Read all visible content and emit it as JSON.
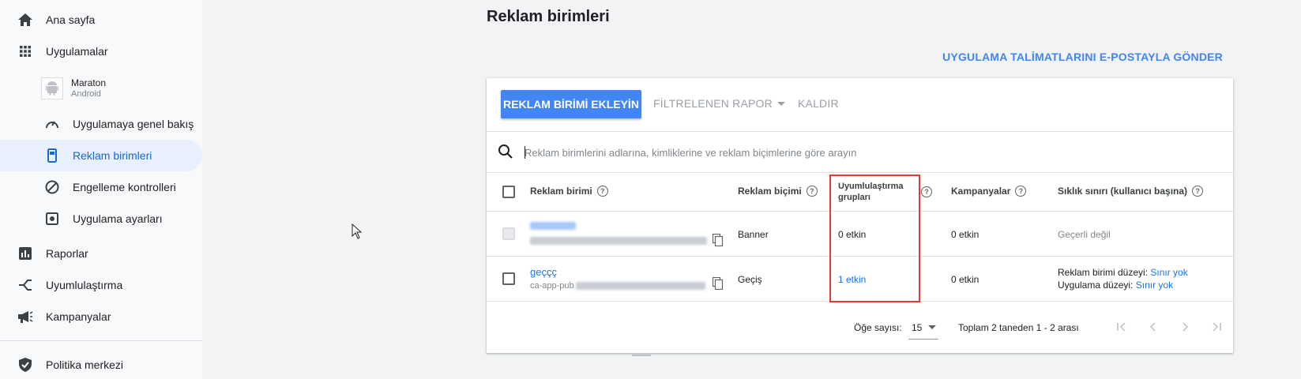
{
  "sidebar": {
    "items": [
      {
        "label": "Ana sayfa",
        "icon": "home-icon"
      },
      {
        "label": "Uygulamalar",
        "icon": "apps-grid-icon"
      },
      {
        "label": "Uygulamaya genel bakış",
        "icon": "speedometer-icon"
      },
      {
        "label": "Reklam birimleri",
        "icon": "ad-unit-icon"
      },
      {
        "label": "Engelleme kontrolleri",
        "icon": "block-icon"
      },
      {
        "label": "Uygulama ayarları",
        "icon": "settings-icon"
      },
      {
        "label": "Raporlar",
        "icon": "reports-icon"
      },
      {
        "label": "Uyumlulaştırma",
        "icon": "mediation-icon"
      },
      {
        "label": "Kampanyalar",
        "icon": "megaphone-icon"
      },
      {
        "label": "Politika merkezi",
        "icon": "shield-check-icon"
      }
    ],
    "app": {
      "name": "Maraton",
      "platform": "Android",
      "icon": "android-icon"
    }
  },
  "main": {
    "title": "Reklam birimleri",
    "email_link": "UYGULAMA TALİMATLARINI E-POSTAYLA GÖNDER",
    "toolbar": {
      "add_label": "REKLAM BİRİMİ EKLEYİN",
      "filtered_report_label": "FİLTRELENEN RAPOR",
      "remove_label": "KALDIR"
    },
    "search": {
      "placeholder": "Reklam birimlerini adlarına, kimliklerine ve reklam biçimlerine göre arayın"
    },
    "table": {
      "columns": {
        "ad_unit": "Reklam birimi",
        "format": "Reklam biçimi",
        "mediation_line1": "Uyumlulaştırma",
        "mediation_line2": "grupları",
        "campaigns": "Kampanyalar",
        "frequency": "Sıklık sınırı (kullanıcı başına)"
      },
      "rows": [
        {
          "format": "Banner",
          "mediation": "0 etkin",
          "campaigns": "0 etkin",
          "frequency": "Geçerli değil"
        },
        {
          "name": "geççç",
          "id_prefix": "ca-app-pub",
          "format": "Geçiş",
          "mediation": "1 etkin",
          "campaigns": "0 etkin",
          "freq_unit_label": "Reklam birimi düzeyi:",
          "freq_unit_value": "Sınır yok",
          "freq_app_label": "Uygulama düzeyi:",
          "freq_app_value": "Sınır yok"
        }
      ]
    },
    "footer": {
      "items_label": "Öğe sayısı:",
      "items_value": "15",
      "total_label": "Toplam 2 taneden 1 - 2 arası"
    }
  },
  "colors": {
    "accent": "#4285f4",
    "link": "#1a73e8",
    "highlight": "#e53935"
  }
}
